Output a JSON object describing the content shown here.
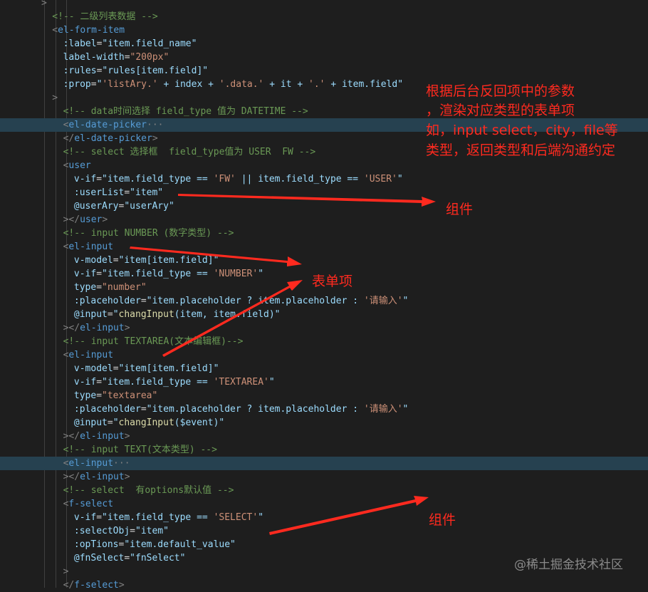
{
  "editor": {
    "theme": {
      "background": "#1e1e1e",
      "highlight": "#264150"
    },
    "lines": [
      {
        "indent": 0,
        "tokens": [
          {
            "t": ">",
            "c": "tagpunct"
          }
        ]
      },
      {
        "indent": 1,
        "tokens": [
          {
            "t": "<!-- 二级列表数据 -->",
            "c": "comment"
          }
        ]
      },
      {
        "indent": 1,
        "tokens": [
          {
            "t": "<",
            "c": "tagpunct"
          },
          {
            "t": "el-form-item",
            "c": "tag"
          }
        ]
      },
      {
        "indent": 2,
        "tokens": [
          {
            "t": ":label",
            "c": "attr"
          },
          {
            "t": "=",
            "c": "punct"
          },
          {
            "t": "\"item.field_name\"",
            "c": "ident"
          }
        ]
      },
      {
        "indent": 2,
        "tokens": [
          {
            "t": "label-width",
            "c": "attr"
          },
          {
            "t": "=",
            "c": "punct"
          },
          {
            "t": "\"200px\"",
            "c": "str"
          }
        ]
      },
      {
        "indent": 2,
        "tokens": [
          {
            "t": ":rules",
            "c": "attr"
          },
          {
            "t": "=",
            "c": "punct"
          },
          {
            "t": "\"rules[item.field]\"",
            "c": "ident"
          }
        ]
      },
      {
        "indent": 2,
        "tokens": [
          {
            "t": ":prop",
            "c": "attr"
          },
          {
            "t": "=",
            "c": "punct"
          },
          {
            "t": "\"",
            "c": "ident"
          },
          {
            "t": "'listAry.'",
            "c": "str"
          },
          {
            "t": " + index + ",
            "c": "ident"
          },
          {
            "t": "'.data.'",
            "c": "str"
          },
          {
            "t": " + it + ",
            "c": "ident"
          },
          {
            "t": "'.'",
            "c": "str"
          },
          {
            "t": " + item.field\"",
            "c": "ident"
          }
        ]
      },
      {
        "indent": 1,
        "tokens": [
          {
            "t": ">",
            "c": "tagpunct"
          }
        ]
      },
      {
        "indent": 2,
        "tokens": [
          {
            "t": "<!-- data时间选择 field_type 值为 DATETIME -->",
            "c": "comment"
          }
        ]
      },
      {
        "indent": 2,
        "hl": true,
        "tokens": [
          {
            "t": "<",
            "c": "tagpunct"
          },
          {
            "t": "el-date-picker",
            "c": "tag"
          },
          {
            "t": "···",
            "c": "tagpunct"
          }
        ]
      },
      {
        "indent": 2,
        "tokens": [
          {
            "t": "</",
            "c": "tagpunct"
          },
          {
            "t": "el-date-picker",
            "c": "tag"
          },
          {
            "t": ">",
            "c": "tagpunct"
          }
        ]
      },
      {
        "indent": 2,
        "tokens": [
          {
            "t": "<!-- select 选择框  field_type值为 USER  FW -->",
            "c": "comment"
          }
        ]
      },
      {
        "indent": 2,
        "tokens": [
          {
            "t": "<",
            "c": "tagpunct"
          },
          {
            "t": "user",
            "c": "tag"
          }
        ]
      },
      {
        "indent": 3,
        "tokens": [
          {
            "t": "v-if",
            "c": "attr"
          },
          {
            "t": "=",
            "c": "punct"
          },
          {
            "t": "\"item.field_type == ",
            "c": "ident"
          },
          {
            "t": "'FW'",
            "c": "str"
          },
          {
            "t": " || item.field_type == ",
            "c": "ident"
          },
          {
            "t": "'USER'",
            "c": "str"
          },
          {
            "t": "\"",
            "c": "ident"
          }
        ]
      },
      {
        "indent": 3,
        "tokens": [
          {
            "t": ":userList",
            "c": "attr"
          },
          {
            "t": "=",
            "c": "punct"
          },
          {
            "t": "\"item\"",
            "c": "ident"
          }
        ]
      },
      {
        "indent": 3,
        "tokens": [
          {
            "t": "@userAry",
            "c": "attr"
          },
          {
            "t": "=",
            "c": "punct"
          },
          {
            "t": "\"userAry\"",
            "c": "ident"
          }
        ]
      },
      {
        "indent": 2,
        "tokens": [
          {
            "t": "></",
            "c": "tagpunct"
          },
          {
            "t": "user",
            "c": "tag"
          },
          {
            "t": ">",
            "c": "tagpunct"
          }
        ]
      },
      {
        "indent": 2,
        "tokens": [
          {
            "t": "<!-- input NUMBER (数字类型) -->",
            "c": "comment"
          }
        ]
      },
      {
        "indent": 2,
        "tokens": [
          {
            "t": "<",
            "c": "tagpunct"
          },
          {
            "t": "el-input",
            "c": "tag"
          }
        ]
      },
      {
        "indent": 3,
        "tokens": [
          {
            "t": "v-model",
            "c": "attr"
          },
          {
            "t": "=",
            "c": "punct"
          },
          {
            "t": "\"item[item.field]\"",
            "c": "ident"
          }
        ]
      },
      {
        "indent": 3,
        "tokens": [
          {
            "t": "v-if",
            "c": "attr"
          },
          {
            "t": "=",
            "c": "punct"
          },
          {
            "t": "\"item.field_type == ",
            "c": "ident"
          },
          {
            "t": "'NUMBER'",
            "c": "str"
          },
          {
            "t": "\"",
            "c": "ident"
          }
        ]
      },
      {
        "indent": 3,
        "tokens": [
          {
            "t": "type",
            "c": "attr"
          },
          {
            "t": "=",
            "c": "punct"
          },
          {
            "t": "\"number\"",
            "c": "str"
          }
        ]
      },
      {
        "indent": 3,
        "tokens": [
          {
            "t": ":placeholder",
            "c": "attr"
          },
          {
            "t": "=",
            "c": "punct"
          },
          {
            "t": "\"item.placeholder ? item.placeholder : ",
            "c": "ident"
          },
          {
            "t": "'请输入'",
            "c": "str"
          },
          {
            "t": "\"",
            "c": "ident"
          }
        ]
      },
      {
        "indent": 3,
        "tokens": [
          {
            "t": "@input",
            "c": "attr"
          },
          {
            "t": "=",
            "c": "punct"
          },
          {
            "t": "\"",
            "c": "ident"
          },
          {
            "t": "changInput",
            "c": "fn"
          },
          {
            "t": "(item, item.field)\"",
            "c": "ident"
          }
        ]
      },
      {
        "indent": 2,
        "tokens": [
          {
            "t": "></",
            "c": "tagpunct"
          },
          {
            "t": "el-input",
            "c": "tag"
          },
          {
            "t": ">",
            "c": "tagpunct"
          }
        ]
      },
      {
        "indent": 2,
        "tokens": [
          {
            "t": "<!-- input TEXTAREA(文本编辑框)-->",
            "c": "comment"
          }
        ]
      },
      {
        "indent": 2,
        "tokens": [
          {
            "t": "<",
            "c": "tagpunct"
          },
          {
            "t": "el-input",
            "c": "tag"
          }
        ]
      },
      {
        "indent": 3,
        "tokens": [
          {
            "t": "v-model",
            "c": "attr"
          },
          {
            "t": "=",
            "c": "punct"
          },
          {
            "t": "\"item[item.field]\"",
            "c": "ident"
          }
        ]
      },
      {
        "indent": 3,
        "tokens": [
          {
            "t": "v-if",
            "c": "attr"
          },
          {
            "t": "=",
            "c": "punct"
          },
          {
            "t": "\"item.field_type == ",
            "c": "ident"
          },
          {
            "t": "'TEXTAREA'",
            "c": "str"
          },
          {
            "t": "\"",
            "c": "ident"
          }
        ]
      },
      {
        "indent": 3,
        "tokens": [
          {
            "t": "type",
            "c": "attr"
          },
          {
            "t": "=",
            "c": "punct"
          },
          {
            "t": "\"textarea\"",
            "c": "str"
          }
        ]
      },
      {
        "indent": 3,
        "tokens": [
          {
            "t": ":placeholder",
            "c": "attr"
          },
          {
            "t": "=",
            "c": "punct"
          },
          {
            "t": "\"item.placeholder ? item.placeholder : ",
            "c": "ident"
          },
          {
            "t": "'请输入'",
            "c": "str"
          },
          {
            "t": "\"",
            "c": "ident"
          }
        ]
      },
      {
        "indent": 3,
        "tokens": [
          {
            "t": "@input",
            "c": "attr"
          },
          {
            "t": "=",
            "c": "punct"
          },
          {
            "t": "\"",
            "c": "ident"
          },
          {
            "t": "changInput",
            "c": "fn"
          },
          {
            "t": "($event)\"",
            "c": "ident"
          }
        ]
      },
      {
        "indent": 2,
        "tokens": [
          {
            "t": "></",
            "c": "tagpunct"
          },
          {
            "t": "el-input",
            "c": "tag"
          },
          {
            "t": ">",
            "c": "tagpunct"
          }
        ]
      },
      {
        "indent": 2,
        "tokens": [
          {
            "t": "<!-- input TEXT(文本类型) -->",
            "c": "comment"
          }
        ]
      },
      {
        "indent": 2,
        "hl": true,
        "tokens": [
          {
            "t": "<",
            "c": "tagpunct"
          },
          {
            "t": "el-input",
            "c": "tag"
          },
          {
            "t": "···",
            "c": "tagpunct"
          }
        ]
      },
      {
        "indent": 2,
        "tokens": [
          {
            "t": "></",
            "c": "tagpunct"
          },
          {
            "t": "el-input",
            "c": "tag"
          },
          {
            "t": ">",
            "c": "tagpunct"
          }
        ]
      },
      {
        "indent": 2,
        "tokens": [
          {
            "t": "<!-- select  有options默认值 -->",
            "c": "comment"
          }
        ]
      },
      {
        "indent": 2,
        "tokens": [
          {
            "t": "<",
            "c": "tagpunct"
          },
          {
            "t": "f-select",
            "c": "tag"
          }
        ]
      },
      {
        "indent": 3,
        "tokens": [
          {
            "t": "v-if",
            "c": "attr"
          },
          {
            "t": "=",
            "c": "punct"
          },
          {
            "t": "\"item.field_type == ",
            "c": "ident"
          },
          {
            "t": "'SELECT'",
            "c": "str"
          },
          {
            "t": "\"",
            "c": "ident"
          }
        ]
      },
      {
        "indent": 3,
        "tokens": [
          {
            "t": ":selectObj",
            "c": "attr"
          },
          {
            "t": "=",
            "c": "punct"
          },
          {
            "t": "\"item\"",
            "c": "ident"
          }
        ]
      },
      {
        "indent": 3,
        "tokens": [
          {
            "t": ":opTions",
            "c": "attr"
          },
          {
            "t": "=",
            "c": "punct"
          },
          {
            "t": "\"item.default_value\"",
            "c": "ident"
          }
        ]
      },
      {
        "indent": 3,
        "tokens": [
          {
            "t": "@fnSelect",
            "c": "attr"
          },
          {
            "t": "=",
            "c": "punct"
          },
          {
            "t": "\"fnSelect\"",
            "c": "ident"
          }
        ]
      },
      {
        "indent": 2,
        "tokens": [
          {
            "t": ">",
            "c": "tagpunct"
          }
        ]
      },
      {
        "indent": 2,
        "tokens": [
          {
            "t": "</",
            "c": "tagpunct"
          },
          {
            "t": "f-select",
            "c": "tag"
          },
          {
            "t": ">",
            "c": "tagpunct"
          }
        ]
      }
    ]
  },
  "annotations": {
    "color": "#ff2a1f",
    "note_lines": [
      "根据后台反回项中的参数",
      "，渲染对应类型的表单项",
      "如，input select，city，file等",
      "类型，返回类型和后端沟通约定"
    ],
    "label_component_top": "组件",
    "label_form_item": "表单项",
    "label_component_bottom": "组件"
  },
  "watermark": "@稀土掘金技术社区"
}
